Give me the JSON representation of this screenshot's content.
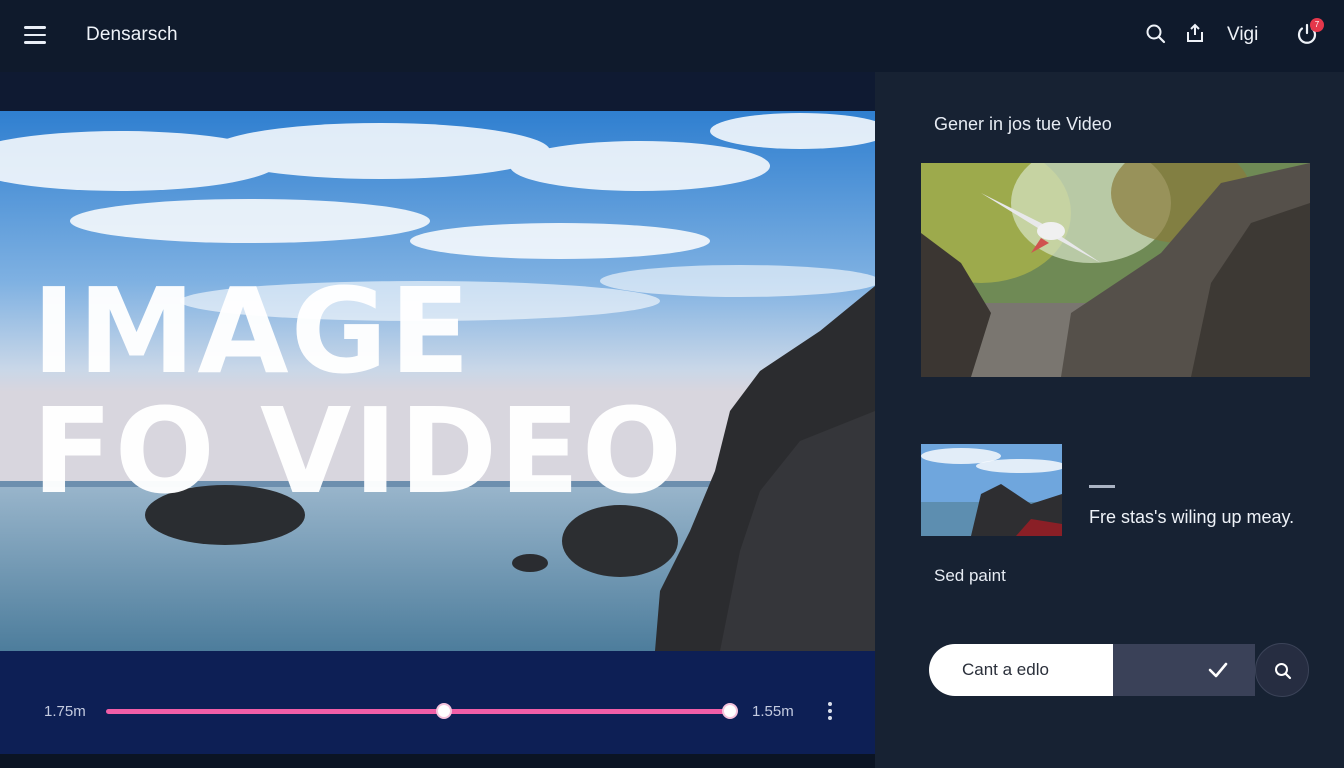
{
  "header": {
    "app_title": "Densarsch",
    "user_label": "Vigi",
    "notification_count": "7",
    "icons": [
      "menu-icon",
      "search-icon",
      "share-icon",
      "power-icon"
    ]
  },
  "player": {
    "hero_line_1": "IMAGE",
    "hero_line_2": "FO VIDEO",
    "time_left": "1.75m",
    "time_right": "1.55m",
    "playhead_position": 0.54,
    "accent_color": "#f05ea7"
  },
  "panel": {
    "title": "Gener in jos tue Video",
    "thumb_caption": "Fre stas's wiling up meay.",
    "section_label": "Sed paint",
    "input_value": "Cant a edlo"
  }
}
